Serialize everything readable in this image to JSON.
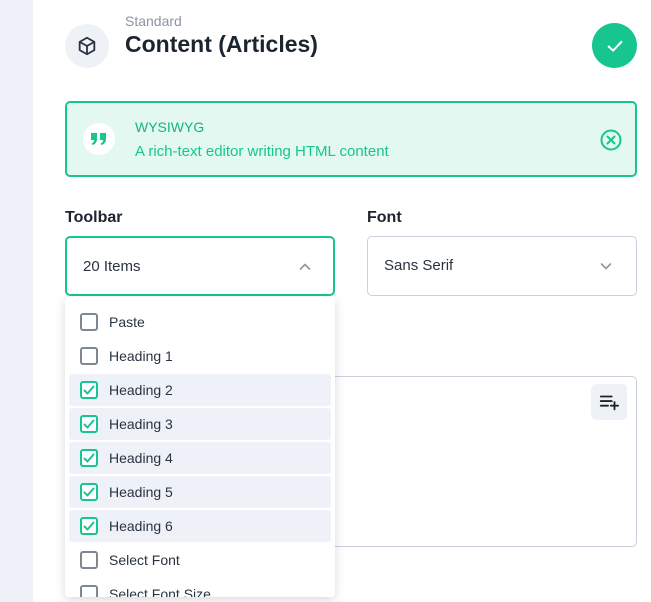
{
  "header": {
    "subtitle": "Standard",
    "title": "Content (Articles)",
    "type_icon": "cube-icon",
    "status_icon": "check-icon"
  },
  "banner": {
    "title": "WYSIWYG",
    "description": "A rich-text editor writing HTML content",
    "icon": "quote-icon",
    "close_icon": "close-circle-icon"
  },
  "toolbar": {
    "label": "Toolbar",
    "value": "20 Items",
    "expanded": true,
    "options": [
      {
        "label": "Paste",
        "checked": false
      },
      {
        "label": "Heading 1",
        "checked": false
      },
      {
        "label": "Heading 2",
        "checked": true
      },
      {
        "label": "Heading 3",
        "checked": true
      },
      {
        "label": "Heading 4",
        "checked": true
      },
      {
        "label": "Heading 5",
        "checked": true
      },
      {
        "label": "Heading 6",
        "checked": true
      },
      {
        "label": "Select Font",
        "checked": false
      },
      {
        "label": "Select Font Size",
        "checked": false
      }
    ]
  },
  "font": {
    "label": "Font",
    "value": "Sans Serif"
  },
  "editor": {
    "add_icon": "playlist-add-icon"
  },
  "colors": {
    "accent": "#17c58f",
    "accent_light": "#e3f8f1",
    "text": "#1c2430",
    "muted": "#8a96a5"
  }
}
